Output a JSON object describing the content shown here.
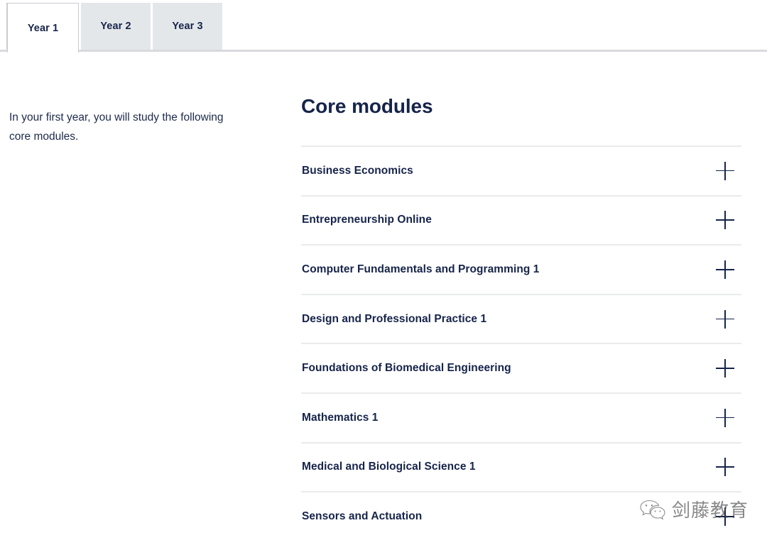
{
  "tabs": [
    {
      "label": "Year 1",
      "active": true
    },
    {
      "label": "Year 2",
      "active": false
    },
    {
      "label": "Year 3",
      "active": false
    }
  ],
  "intro": {
    "text": "In your first year, you will study the following core modules."
  },
  "modules_section": {
    "heading": "Core modules",
    "expand_icon": "plus-icon",
    "items": [
      {
        "title": "Business Economics"
      },
      {
        "title": "Entrepreneurship Online"
      },
      {
        "title": "Computer Fundamentals and Programming 1"
      },
      {
        "title": "Design and Professional Practice 1"
      },
      {
        "title": "Foundations of Biomedical Engineering"
      },
      {
        "title": "Mathematics 1"
      },
      {
        "title": "Medical and Biological Science 1"
      },
      {
        "title": "Sensors and Actuation"
      }
    ]
  },
  "watermark": {
    "icon": "wechat-logo-icon",
    "text": "剑藤教育"
  },
  "colors": {
    "text_navy": "#16244a",
    "tab_inactive_bg": "#e4e7e9",
    "tab_border": "#c9ccd2",
    "divider": "#e9ebec",
    "rule": "#d9dade"
  }
}
